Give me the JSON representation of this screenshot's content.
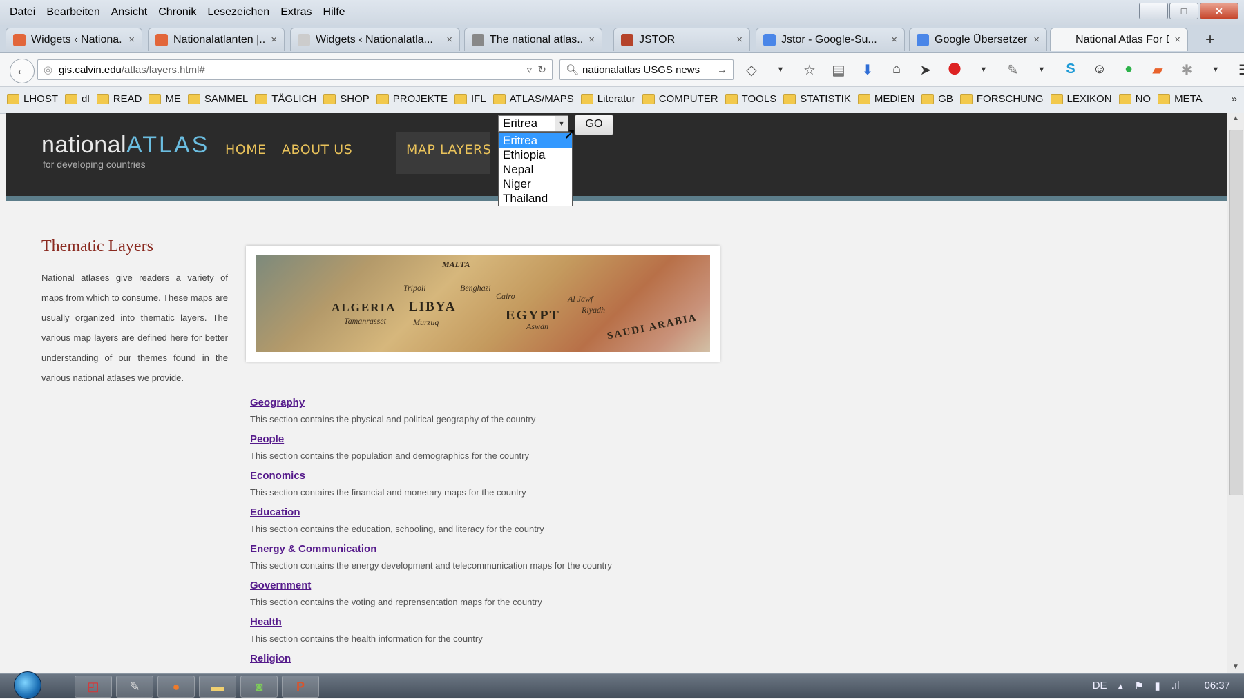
{
  "menu": [
    "Datei",
    "Bearbeiten",
    "Ansicht",
    "Chronik",
    "Lesezeichen",
    "Extras",
    "Hilfe"
  ],
  "window_controls": {
    "minimize": "–",
    "maximize": "□",
    "close": "✕"
  },
  "tabs": [
    {
      "label": "Widgets ‹ Nationa...",
      "icon_color": "#e2663a"
    },
    {
      "label": "Nationalatlanten |...",
      "icon_color": "#e2663a"
    },
    {
      "label": "Widgets ‹ Nationalatla...",
      "icon_color": "#cccccc"
    },
    {
      "label": "The national atlas...",
      "icon_color": "#888888"
    },
    {
      "label": "JSTOR",
      "icon_color": "#b5432a"
    },
    {
      "label": "Jstor - Google-Su...",
      "icon_color": "#4a86e8"
    },
    {
      "label": "Google Übersetzer",
      "icon_color": "#4a86e8"
    },
    {
      "label": "National Atlas For Dev...",
      "icon_color": "#f5f6f7"
    }
  ],
  "tab_close": "×",
  "new_tab": "+",
  "url": {
    "host": "gis.calvin.edu",
    "path": "/atlas/layers.html#"
  },
  "search": {
    "value": "nationalatlas USGS news"
  },
  "toolbar_icons": [
    "tag-icon",
    "dropdown-icon",
    "star-icon",
    "reader-icon",
    "download-icon",
    "home-icon",
    "send-icon",
    "adblock-icon",
    "dropdown-icon",
    "pen-icon",
    "dropdown-icon",
    "skype-icon",
    "chat-icon",
    "evernote-icon",
    "highlighter-icon",
    "plugin-icon",
    "dropdown-icon",
    "menu-icon"
  ],
  "bookmarks": [
    "LHOST",
    "dl",
    "READ",
    "ME",
    "SAMMEL",
    "TÄGLICH",
    "SHOP",
    "PROJEKTE",
    "IFL",
    "ATLAS/MAPS",
    "Literatur",
    "COMPUTER",
    "TOOLS",
    "STATISTIK",
    "MEDIEN",
    "GB",
    "FORSCHUNG",
    "LEXIKON",
    "NO",
    "META"
  ],
  "site": {
    "logo_main": "national",
    "logo_accent": "ATLAS",
    "logo_sub": "for developing countries",
    "nav": [
      "HOME",
      "ABOUT US",
      "MAP LAYERS"
    ],
    "country_select": {
      "selected": "Eritrea",
      "options": [
        "Eritrea",
        "Ethiopia",
        "Nepal",
        "Niger",
        "Thailand"
      ]
    },
    "go_label": "GO"
  },
  "sidebar": {
    "title": "Thematic Layers",
    "text": "National atlases give readers a variety of maps from which to consume. These maps are usually organized into thematic layers. The various map layers are defined here for better understanding of our themes found in the various national atlases we provide."
  },
  "banner": {
    "countries": [
      "ALGERIA",
      "LIBYA",
      "EGYPT",
      "SAUDI ARABIA"
    ],
    "towns": [
      "Tamanrasset",
      "Murzuq",
      "Tripoli",
      "Benghazi",
      "Cairo",
      "Aswân",
      "Al Jawf",
      "Riyadh",
      "MALTA"
    ]
  },
  "layers": [
    {
      "title": "Geography",
      "desc": "This section contains the physical and political geography of the country"
    },
    {
      "title": "People",
      "desc": "This section contains the population and demographics for the country"
    },
    {
      "title": "Economics",
      "desc": "This section contains the financial and monetary maps for the country"
    },
    {
      "title": "Education",
      "desc": "This section contains the education, schooling, and literacy for the country"
    },
    {
      "title": "Energy & Communication",
      "desc": "This section contains the energy development and telecommunication maps for the country"
    },
    {
      "title": "Government",
      "desc": "This section contains the voting and reprensentation maps for the country"
    },
    {
      "title": "Health",
      "desc": "This section contains the health information for the country"
    },
    {
      "title": "Religion",
      "desc": ""
    }
  ],
  "taskbar": {
    "apps": [
      "pdf-icon",
      "notepad-icon",
      "firefox-icon",
      "explorer-icon",
      "app-icon",
      "powerpoint-icon"
    ],
    "lang": "DE",
    "clock": "06:37"
  }
}
